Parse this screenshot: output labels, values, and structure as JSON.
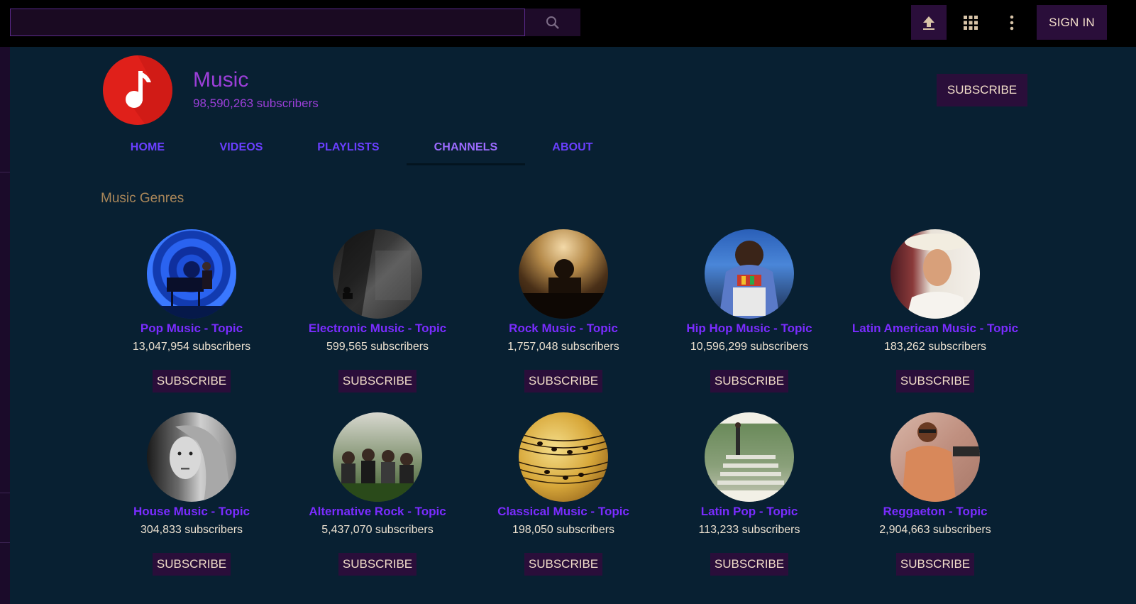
{
  "topbar": {
    "search": {
      "placeholder": "",
      "value": "",
      "button_icon": "search-icon"
    },
    "upload_icon": "upload-icon",
    "apps_icon": "apps-grid-icon",
    "more_icon": "more-vertical-icon",
    "signin_label": "SIGN IN"
  },
  "channel": {
    "title": "Music",
    "subscribers": "98,590,263 subscribers",
    "subscribe_label": "SUBSCRIBE",
    "avatar_color": "#e0201a"
  },
  "tabs": [
    {
      "label": "HOME",
      "active": false
    },
    {
      "label": "VIDEOS",
      "active": false
    },
    {
      "label": "PLAYLISTS",
      "active": false
    },
    {
      "label": "CHANNELS",
      "active": true
    },
    {
      "label": "ABOUT",
      "active": false
    }
  ],
  "section": {
    "title": "Music Genres",
    "channels": [
      {
        "name": "Pop Music - Topic",
        "subscribers": "13,047,954 subscribers",
        "subscribe_label": "SUBSCRIBE"
      },
      {
        "name": "Electronic Music - Topic",
        "subscribers": "599,565 subscribers",
        "subscribe_label": "SUBSCRIBE"
      },
      {
        "name": "Rock Music - Topic",
        "subscribers": "1,757,048 subscribers",
        "subscribe_label": "SUBSCRIBE"
      },
      {
        "name": "Hip Hop Music - Topic",
        "subscribers": "10,596,299 subscribers",
        "subscribe_label": "SUBSCRIBE"
      },
      {
        "name": "Latin American Music - Topic",
        "subscribers": "183,262 subscribers",
        "subscribe_label": "SUBSCRIBE"
      },
      {
        "name": "House Music - Topic",
        "subscribers": "304,833 subscribers",
        "subscribe_label": "SUBSCRIBE"
      },
      {
        "name": "Alternative Rock - Topic",
        "subscribers": "5,437,070 subscribers",
        "subscribe_label": "SUBSCRIBE"
      },
      {
        "name": "Classical Music - Topic",
        "subscribers": "198,050 subscribers",
        "subscribe_label": "SUBSCRIBE"
      },
      {
        "name": "Latin Pop - Topic",
        "subscribers": "113,233 subscribers",
        "subscribe_label": "SUBSCRIBE"
      },
      {
        "name": "Reggaeton - Topic",
        "subscribers": "2,904,663 subscribers",
        "subscribe_label": "SUBSCRIBE"
      }
    ]
  },
  "colors": {
    "background": "#082032",
    "topbar": "#000000",
    "button_bg": "#2a0e3a",
    "button_text": "#f1ddc9",
    "link": "#7a2cff",
    "channel_title": "#9b3fd8",
    "section_title": "#a98659"
  }
}
